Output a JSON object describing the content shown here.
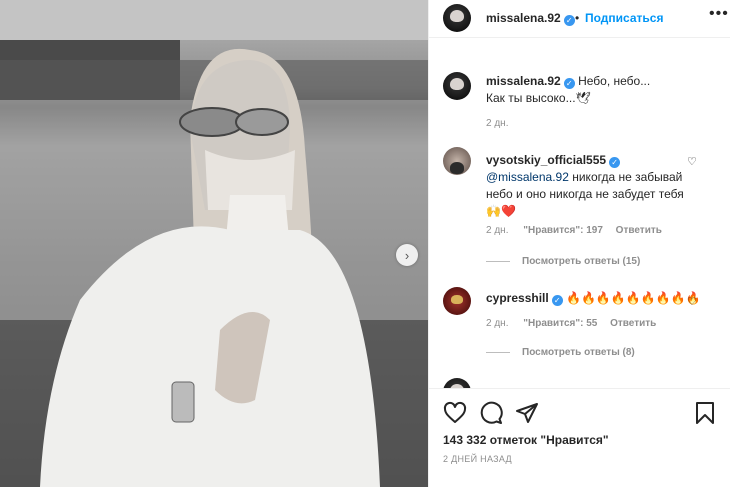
{
  "post": {
    "username": "missalena.92",
    "follow_label": "Подписаться",
    "more_label": "•••",
    "next_label": "›"
  },
  "caption": {
    "username": "missalena.92",
    "text_line1": "Небо, небо...",
    "text_line2": "Как ты высоко...🕊",
    "time": "2 дн."
  },
  "comments": [
    {
      "username": "vysotskiy_official555",
      "mention": "@missalena.92",
      "text": " никогда не забывай небо и оно никогда не забудет тебя 🙌❤️",
      "time": "2 дн.",
      "likes": "\"Нравится\": 197",
      "reply_label": "Ответить",
      "replies_label": "Посмотреть ответы (15)"
    },
    {
      "username": "cypresshill",
      "text": "🔥🔥🔥🔥🔥🔥🔥🔥🔥",
      "time": "2 дн.",
      "likes": "\"Нравится\": 55",
      "reply_label": "Ответить",
      "replies_label": "Посмотреть ответы (8)"
    }
  ],
  "footer": {
    "likes_count": "143 332 отметок \"Нравится\"",
    "date": "2 ДНЕЙ НАЗАД"
  },
  "icons": {
    "like": "heart-icon",
    "comment": "comment-icon",
    "share": "share-icon",
    "save": "bookmark-icon"
  },
  "colors": {
    "accent": "#0095f6",
    "verified": "#3897f0",
    "muted": "#8e8e8e"
  }
}
